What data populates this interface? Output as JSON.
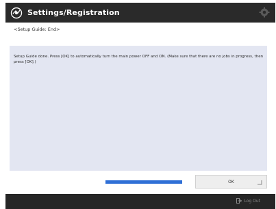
{
  "header": {
    "title": "Settings/Registration",
    "app_icon": "settings-registration-icon",
    "gear_icon": "gear-icon"
  },
  "breadcrumb": "<Setup Guide: End>",
  "message": "Setup Guide done. Press [OK] to automatically turn the main power OFF and ON. (Make sure that there are no jobs in progress, then press [OK].)",
  "progress": {
    "value": 1.0
  },
  "ok_button": {
    "label": "OK"
  },
  "footer": {
    "logout_label": "Log Out",
    "logout_icon": "logout-icon"
  },
  "colors": {
    "header_bg": "#2a2a2a",
    "panel_bg": "#e3e6f2",
    "progress_fill": "#2f6fd6",
    "footer_bg": "#262626"
  }
}
